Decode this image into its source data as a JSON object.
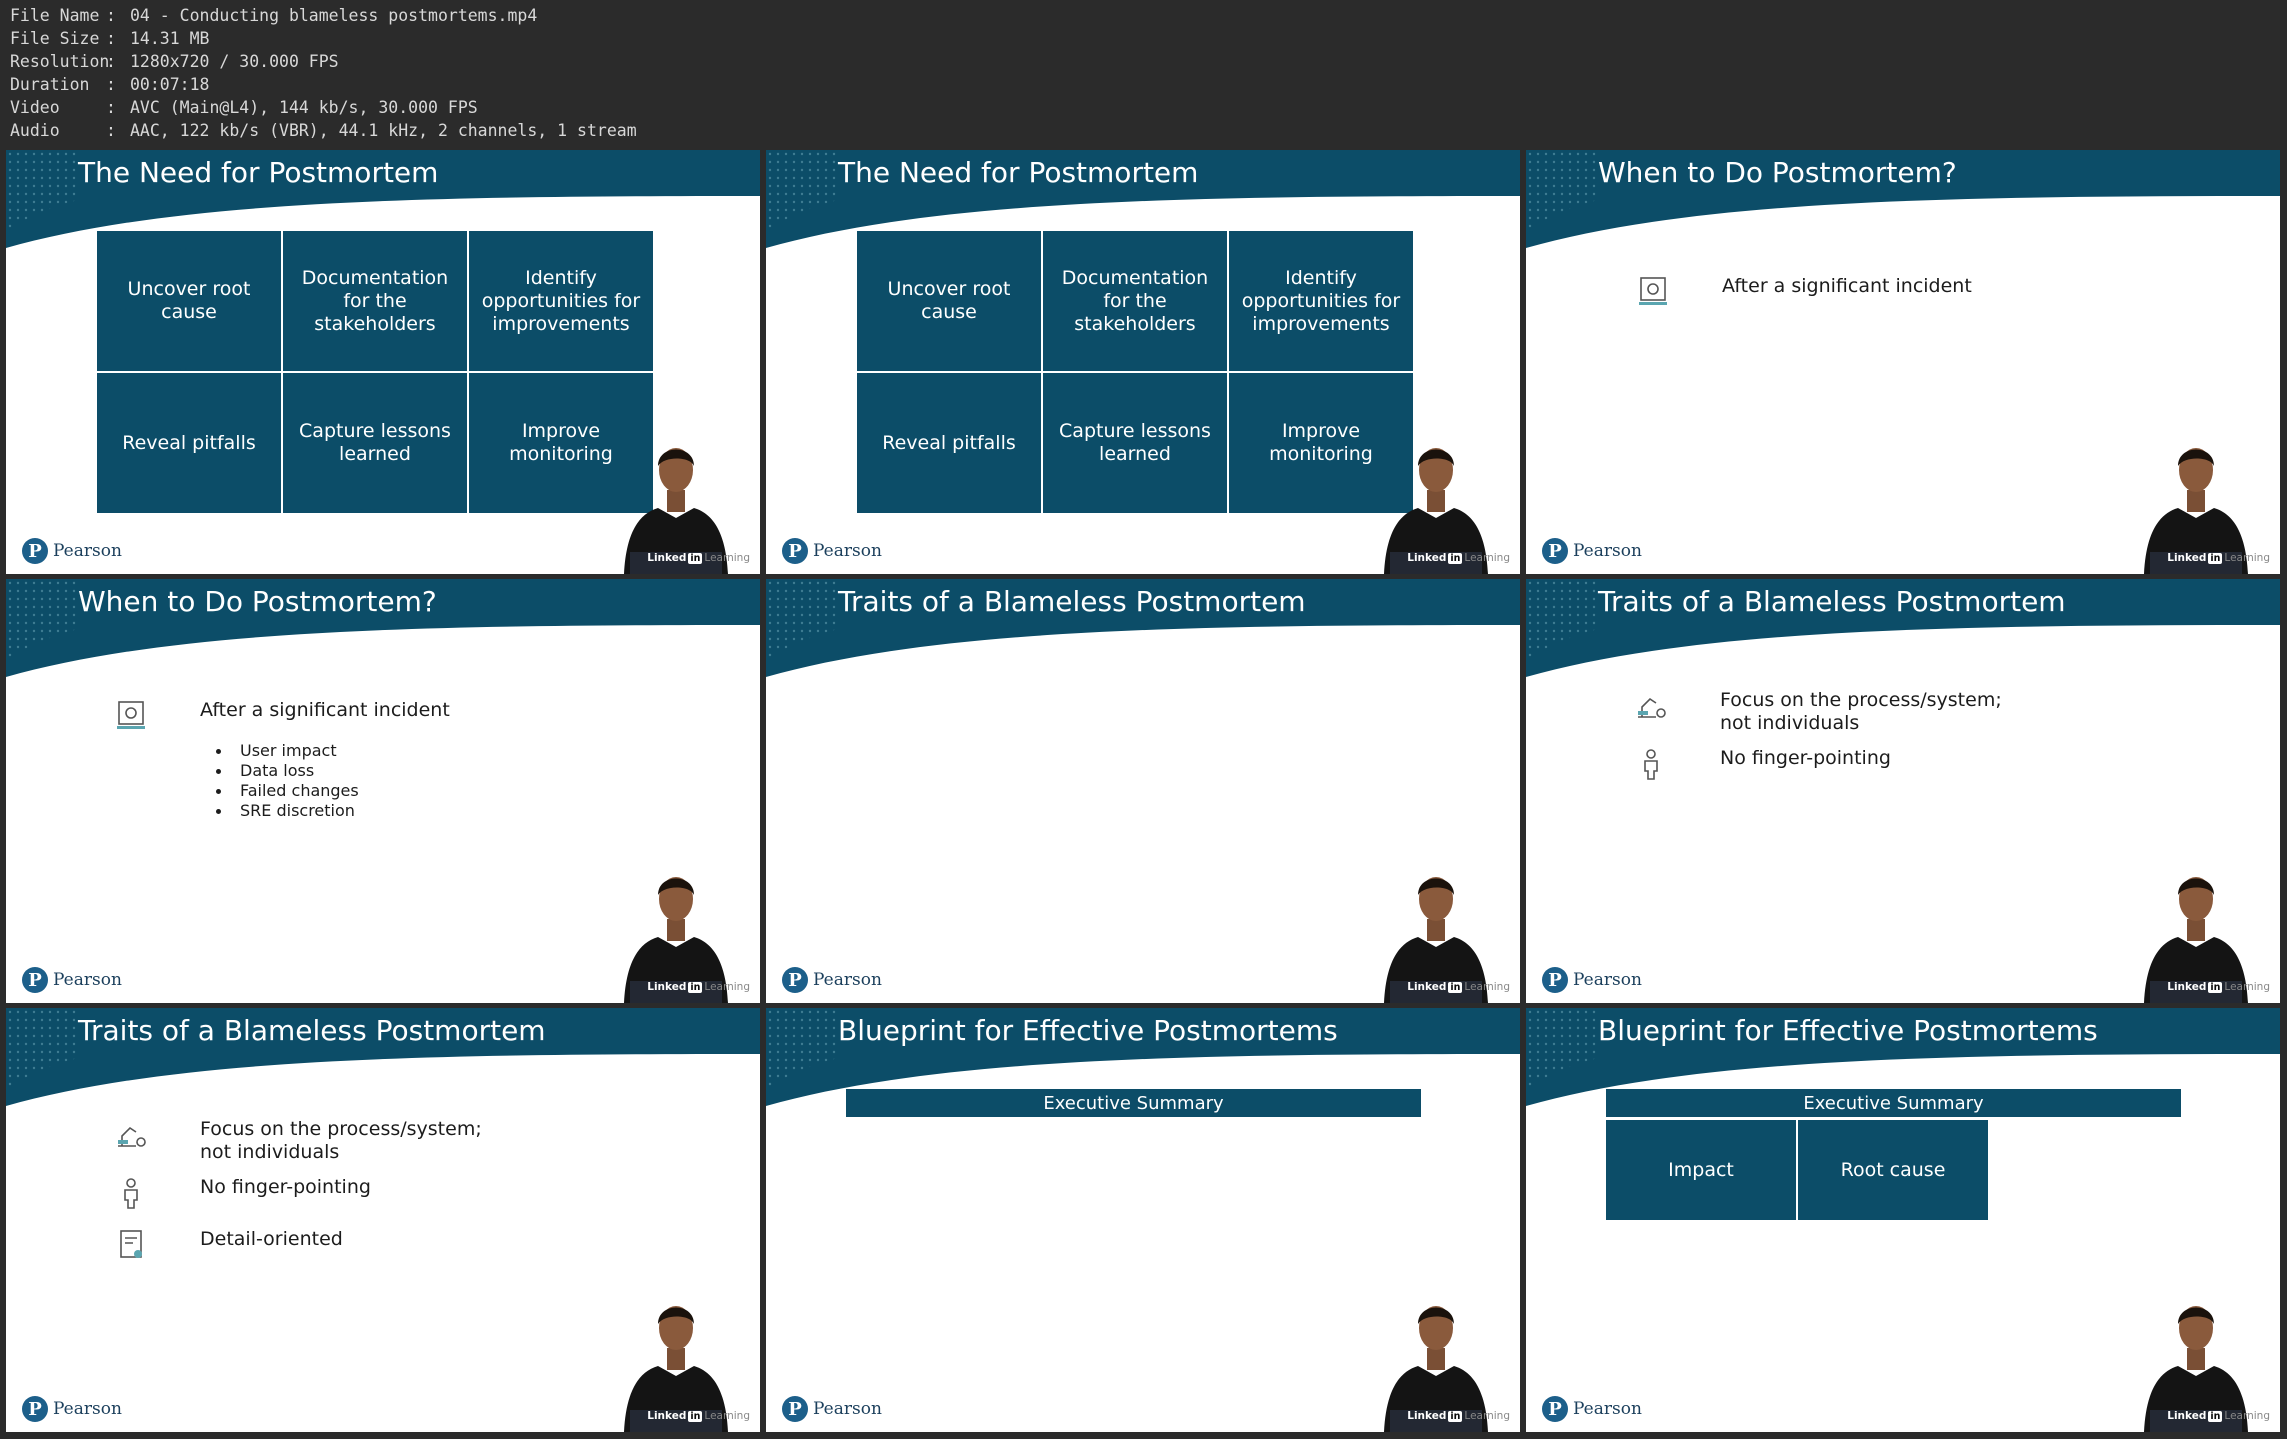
{
  "file_info": [
    {
      "key": "File Name",
      "value": "04 - Conducting blameless postmortems.mp4"
    },
    {
      "key": "File Size",
      "value": "14.31 MB"
    },
    {
      "key": "Resolution",
      "value": "1280x720 / 30.000 FPS"
    },
    {
      "key": "Duration",
      "value": "00:07:18"
    },
    {
      "key": "Video",
      "value": "AVC (Main@L4), 144 kb/s, 30.000 FPS"
    },
    {
      "key": "Audio",
      "value": "AAC, 122 kb/s (VBR), 44.1 kHz, 2 channels, 1 stream"
    }
  ],
  "separator": ":",
  "brand": {
    "pearson": "Pearson",
    "linkedin_prefix": "Linked",
    "linkedin_in": "in",
    "linkedin_suffix": "Learning"
  },
  "colors": {
    "band": "#0c4d68",
    "background": "#2b2b2b"
  },
  "slides": [
    {
      "title": "The Need for Postmortem",
      "matrix": [
        "Uncover root cause",
        "Documentation for the stakeholders",
        "Identify opportunities for improvements",
        "Reveal pitfalls",
        "Capture lessons learned",
        "Improve monitoring"
      ]
    },
    {
      "title": "The Need for Postmortem",
      "matrix": [
        "Uncover root cause",
        "Documentation for the stakeholders",
        "Identify opportunities for improvements",
        "Reveal pitfalls",
        "Capture lessons learned",
        "Improve monitoring"
      ]
    },
    {
      "title": "When to Do Postmortem?",
      "items": [
        {
          "text": "After a significant incident",
          "icon": "monitor-icon"
        }
      ]
    },
    {
      "title": "When to Do Postmortem?",
      "items": [
        {
          "text": "After a significant incident",
          "icon": "monitor-icon"
        }
      ],
      "bullets": [
        "User impact",
        "Data loss",
        "Failed changes",
        "SRE discretion"
      ]
    },
    {
      "title": "Traits of a Blameless Postmortem"
    },
    {
      "title": "Traits of a Blameless Postmortem",
      "items": [
        {
          "text": "Focus on the process/system;\nnot individuals",
          "icon": "process-icon"
        },
        {
          "text": "No finger-pointing",
          "icon": "person-icon"
        }
      ]
    },
    {
      "title": "Traits of a Blameless Postmortem",
      "items": [
        {
          "text": "Focus on the process/system;\nnot individuals",
          "icon": "process-icon"
        },
        {
          "text": "No finger-pointing",
          "icon": "person-icon"
        },
        {
          "text": "Detail-oriented",
          "icon": "detail-icon"
        }
      ]
    },
    {
      "title": "Blueprint for Effective Postmortems",
      "exec": "Executive Summary"
    },
    {
      "title": "Blueprint for Effective Postmortems",
      "exec": "Executive Summary",
      "subs": [
        "Impact",
        "Root cause"
      ]
    }
  ]
}
